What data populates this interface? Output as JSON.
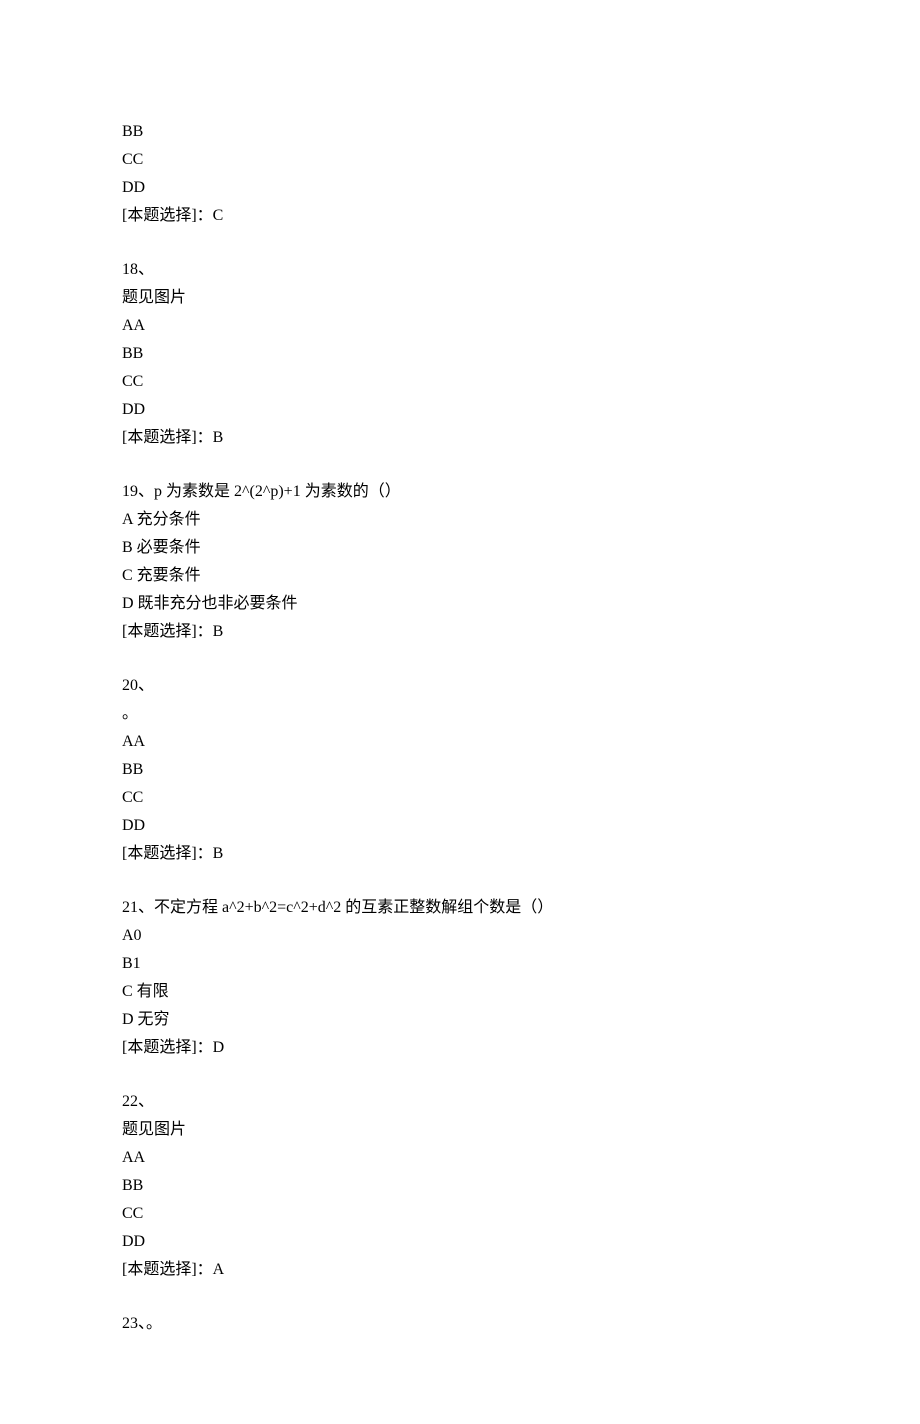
{
  "q17_tail": {
    "options": [
      "BB",
      "CC",
      "DD"
    ],
    "answer_label": "[本题选择]：C"
  },
  "q18": {
    "header": "18、",
    "stem": "题见图片",
    "options": [
      "AA",
      "BB",
      "CC",
      "DD"
    ],
    "answer_label": "[本题选择]：B"
  },
  "q19": {
    "header": "19、p 为素数是 2^(2^p)+1 为素数的（）",
    "options": [
      "A 充分条件",
      "B 必要条件",
      "C 充要条件",
      "D 既非充分也非必要条件"
    ],
    "answer_label": "[本题选择]：B"
  },
  "q20": {
    "header": "20、",
    "stem": "。",
    "options": [
      "AA",
      "BB",
      "CC",
      "DD"
    ],
    "answer_label": "[本题选择]：B"
  },
  "q21": {
    "header": "21、不定方程 a^2+b^2=c^2+d^2 的互素正整数解组个数是（）",
    "options": [
      "A0",
      "B1",
      "C 有限",
      "D 无穷"
    ],
    "answer_label": "[本题选择]：D"
  },
  "q22": {
    "header": "22、",
    "stem": "题见图片",
    "options": [
      "AA",
      "BB",
      "CC",
      "DD"
    ],
    "answer_label": "[本题选择]：A"
  },
  "q23": {
    "header": "23、。"
  }
}
